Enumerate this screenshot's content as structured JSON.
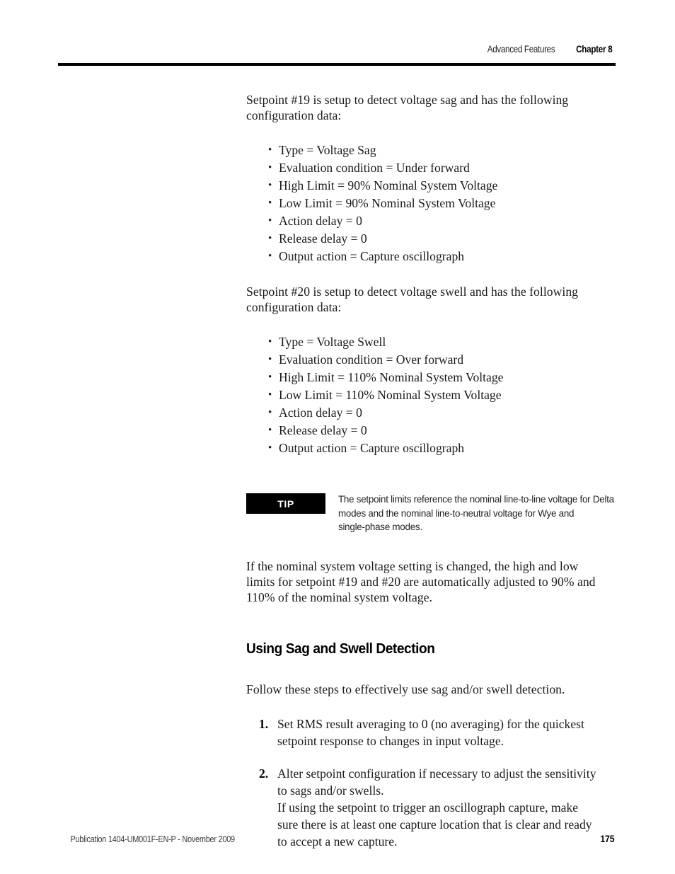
{
  "header": {
    "section": "Advanced Features",
    "chapter": "Chapter 8"
  },
  "main": {
    "intro_sag": {
      "line1": "Setpoint #19 is setup to detect voltage sag and has the following",
      "line2": "configuration data:"
    },
    "sag_bullets": [
      "Type = Voltage Sag",
      "Evaluation condition = Under forward",
      "High Limit = 90% Nominal System Voltage",
      "Low Limit = 90% Nominal System Voltage",
      "Action delay = 0",
      "Release delay = 0",
      "Output action = Capture oscillograph"
    ],
    "intro_swell": {
      "line1": "Setpoint #20 is setup to detect voltage swell and has the following",
      "line2": "configuration data:"
    },
    "swell_bullets": [
      "Type = Voltage Swell",
      "Evaluation condition = Over forward",
      "High Limit = 110% Nominal System Voltage",
      "Low Limit = 110% Nominal System Voltage",
      "Action delay = 0",
      "Release delay = 0",
      "Output action = Capture oscillograph"
    ],
    "tip": {
      "badge": "TIP",
      "line1": "The setpoint limits reference the nominal line-to-line voltage for Delta",
      "line2": "modes and the nominal line-to-neutral voltage for Wye and",
      "line3": "single-phase modes."
    },
    "nominal_note": {
      "line1": "If the nominal system voltage setting is changed, the high and low",
      "line2": "limits for setpoint #19 and #20 are automatically adjusted to 90% and",
      "line3": "110% of the nominal system voltage."
    },
    "section_heading": "Using Sag and Swell Detection",
    "follow_intro": "Follow these steps to effectively use sag and/or swell detection.",
    "steps": [
      {
        "number": "1.",
        "line1": "Set RMS result averaging to 0 (no averaging) for the quickest",
        "line2": "setpoint response to changes in input voltage."
      },
      {
        "number": "2.",
        "line1": "Alter setpoint configuration if necessary to adjust the sensitivity",
        "line2": "to sags and/or swells."
      }
    ],
    "step2_note": {
      "line1": "If using the setpoint to trigger an oscillograph capture, make",
      "line2": "sure there is at least one capture location that is clear and ready",
      "line3": "to accept a new capture."
    }
  },
  "footer": {
    "publication": "Publication 1404-UM001F-EN-P - November 2009",
    "page_number": "175"
  }
}
